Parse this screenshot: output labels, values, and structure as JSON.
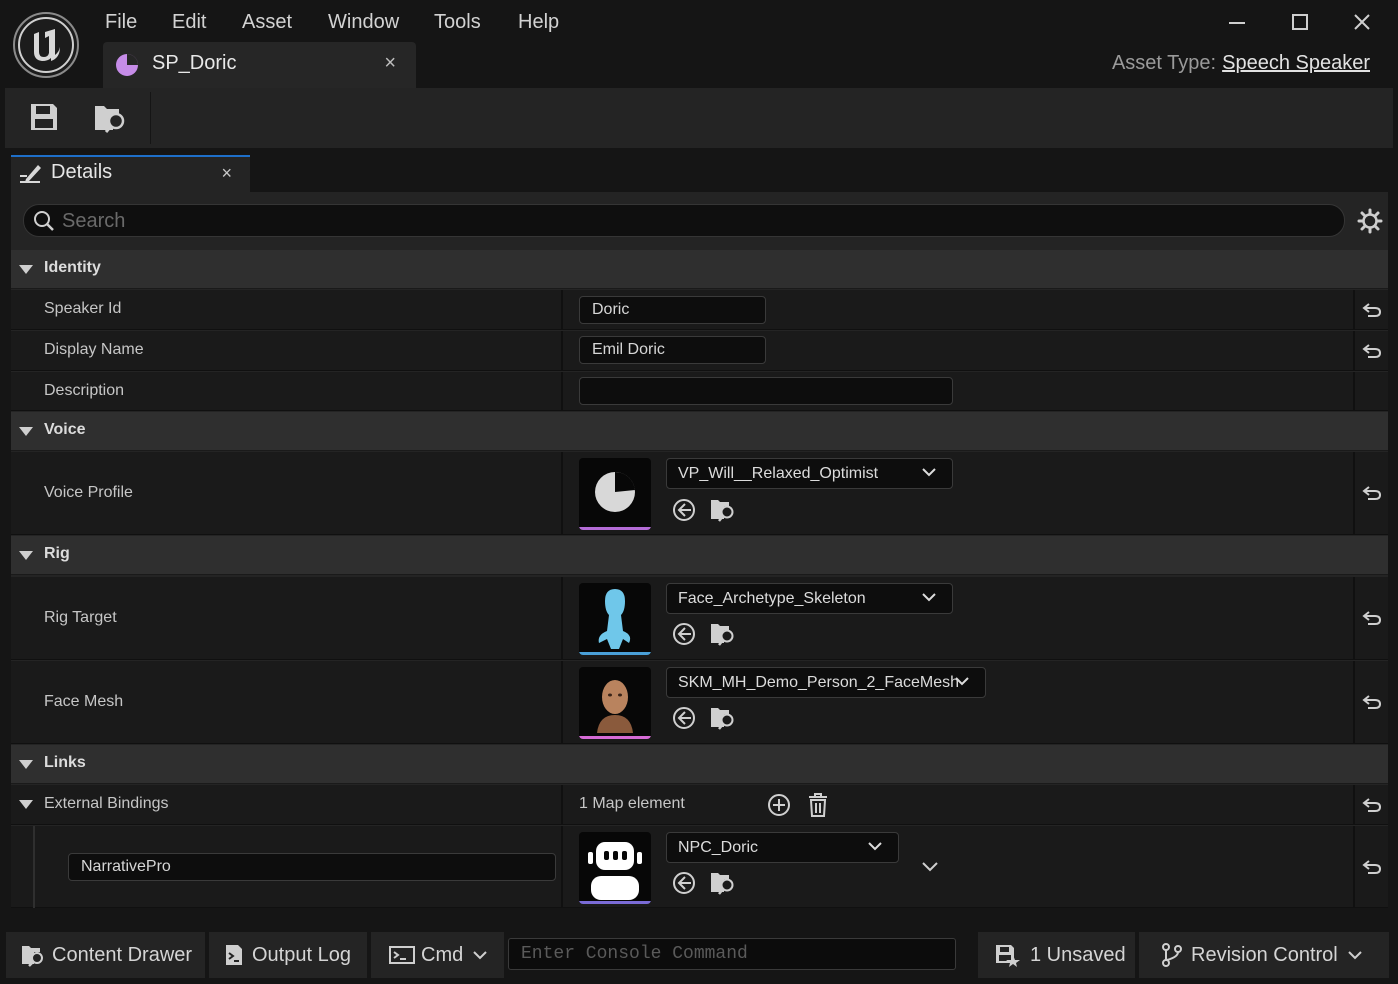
{
  "menu": [
    "File",
    "Edit",
    "Asset",
    "Window",
    "Tools",
    "Help"
  ],
  "document_tab": {
    "label": "SP_Doric",
    "close": "×"
  },
  "asset_type": {
    "label": "Asset Type:",
    "value": "Speech Speaker"
  },
  "details_tab": {
    "label": "Details",
    "close": "×"
  },
  "search": {
    "placeholder": "Search",
    "value": ""
  },
  "categories": {
    "identity": "Identity",
    "voice": "Voice",
    "rig": "Rig",
    "links": "Links"
  },
  "properties": {
    "speaker_id": {
      "label": "Speaker Id",
      "value": "Doric"
    },
    "display_name": {
      "label": "Display Name",
      "value": "Emil Doric"
    },
    "description": {
      "label": "Description",
      "value": ""
    },
    "voice_profile": {
      "label": "Voice Profile",
      "value": "VP_Will__Relaxed_Optimist",
      "thumb_color": "#b36bd6"
    },
    "rig_target": {
      "label": "Rig Target",
      "value": "Face_Archetype_Skeleton",
      "thumb_color": "#4aa0d8"
    },
    "face_mesh": {
      "label": "Face Mesh",
      "value": "SKM_MH_Demo_Person_2_FaceMesh",
      "thumb_color": "#d66bd6"
    },
    "external_bindings": {
      "label": "External Bindings",
      "summary": "1 Map element"
    },
    "binding_entry": {
      "key": "NarrativePro",
      "value": "NPC_Doric",
      "thumb_color": "#7a6bd6"
    }
  },
  "statusbar": {
    "content_drawer": "Content Drawer",
    "output_log": "Output Log",
    "cmd": "Cmd",
    "console_placeholder": "Enter Console Command",
    "unsaved": "1 Unsaved",
    "revision_control": "Revision Control"
  },
  "colors": {
    "accent_blue": "#1e6fc9",
    "panel": "#242424",
    "row": "#1a1a1a",
    "category": "#2f2f2f"
  }
}
